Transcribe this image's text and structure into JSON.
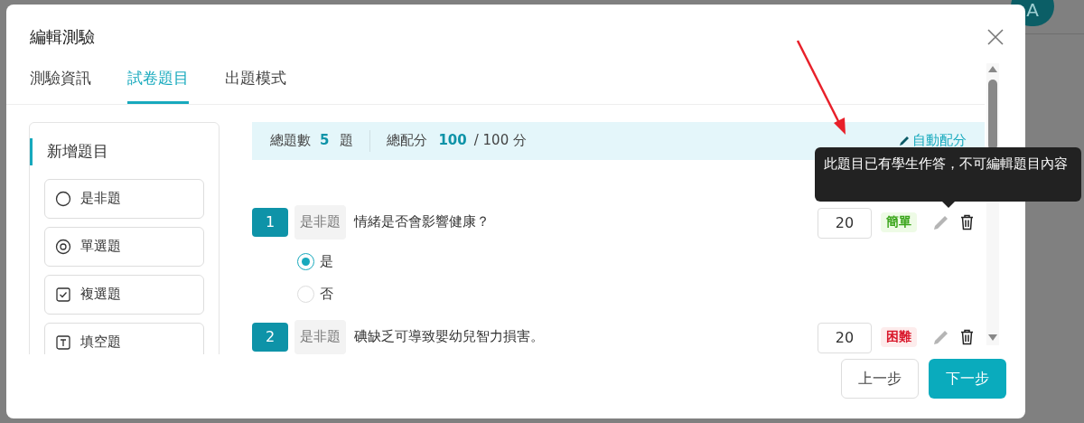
{
  "window": {
    "title": "編輯測驗"
  },
  "avatar": {
    "initial": "A"
  },
  "tabs": [
    {
      "label": "測驗資訊",
      "selected": false
    },
    {
      "label": "試卷題目",
      "selected": true
    },
    {
      "label": "出題模式",
      "selected": false
    }
  ],
  "sidebar": {
    "title": "新增題目",
    "items": [
      {
        "label": "是非題",
        "kind": "true_false"
      },
      {
        "label": "單選題",
        "kind": "single"
      },
      {
        "label": "複選題",
        "kind": "multiple"
      },
      {
        "label": "填空題",
        "kind": "blank"
      }
    ]
  },
  "summary": {
    "count_label": "總題數",
    "count": "5",
    "count_unit": "題",
    "score_label": "總配分",
    "score": "100",
    "score_total": "/ 100 分",
    "auto_link": "自動配分"
  },
  "questions": [
    {
      "number": "1",
      "type": "是非題",
      "text": "情緒是否會影響健康？",
      "score": "20",
      "difficulty": {
        "label": "簡單",
        "kind": "easy"
      },
      "edit_disabled": true,
      "options": [
        {
          "label": "是",
          "selected": true
        },
        {
          "label": "否",
          "selected": false
        }
      ]
    },
    {
      "number": "2",
      "type": "是非題",
      "text": "碘缺乏可導致嬰幼兒智力損害。",
      "score": "20",
      "difficulty": {
        "label": "困難",
        "kind": "hard"
      },
      "edit_disabled": true
    }
  ],
  "tooltip": "此題目已有學生作答，不可編輯題目內容",
  "buttons": [
    {
      "label": "上一步",
      "kind": "secondary"
    },
    {
      "label": "下一步",
      "kind": "primary"
    }
  ]
}
